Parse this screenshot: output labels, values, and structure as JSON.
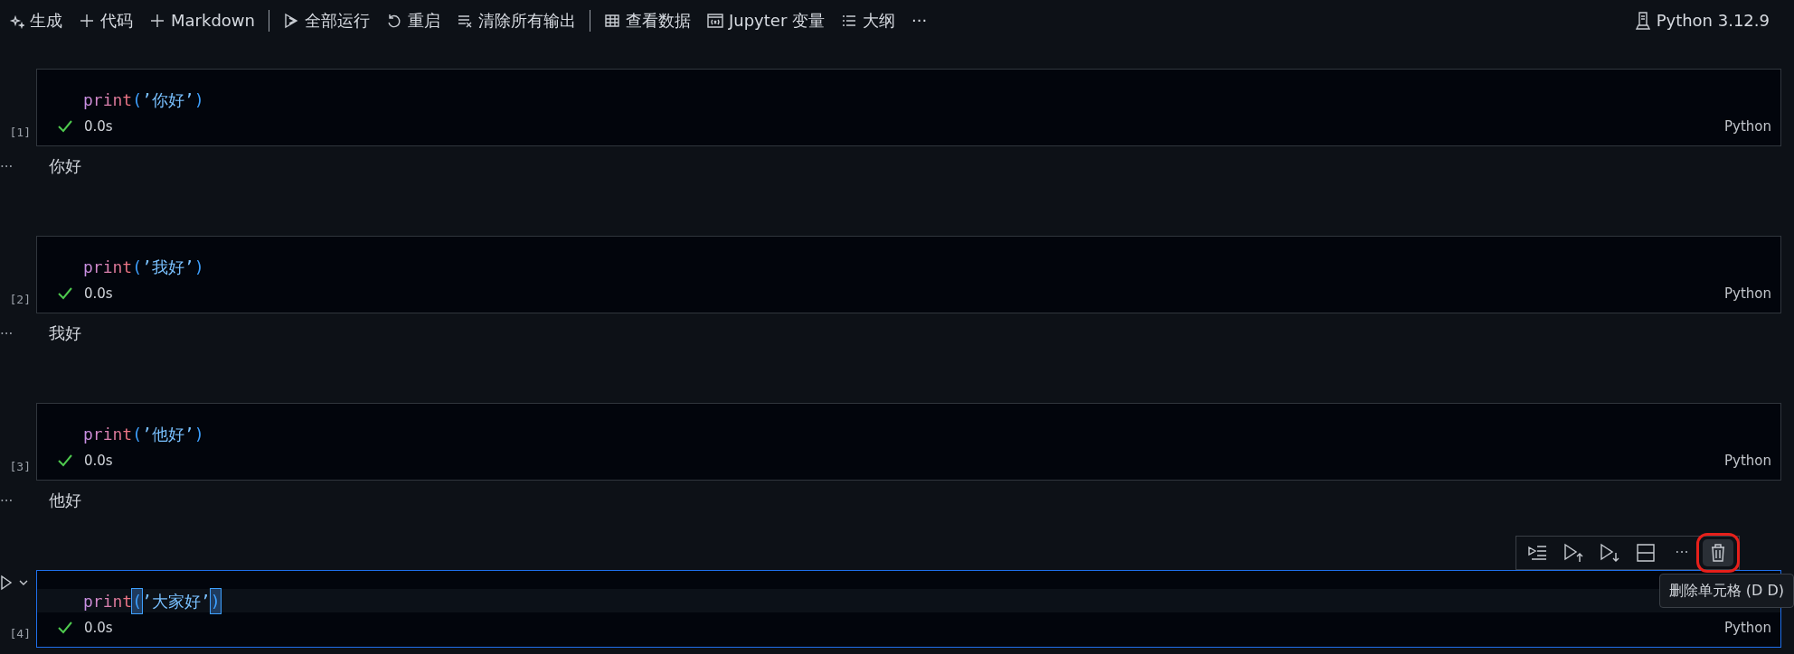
{
  "toolbar": {
    "items": [
      {
        "kind": "sparkle",
        "label": "生成"
      },
      {
        "kind": "plus",
        "label": "代码"
      },
      {
        "kind": "plus",
        "label": "Markdown"
      },
      {
        "kind": "divider"
      },
      {
        "kind": "run-all",
        "label": "全部运行"
      },
      {
        "kind": "restart",
        "label": "重启"
      },
      {
        "kind": "clear",
        "label": "清除所有输出"
      },
      {
        "kind": "divider"
      },
      {
        "kind": "data",
        "label": "查看数据"
      },
      {
        "kind": "variables",
        "label": "Jupyter 变量"
      },
      {
        "kind": "outline",
        "label": "大纲"
      },
      {
        "kind": "more",
        "label": "···"
      }
    ],
    "kernel": {
      "label": "Python 3.12.9"
    }
  },
  "cells": [
    {
      "exec_count": "[1]",
      "selected": false,
      "code": [
        {
          "kind": "function",
          "text": "print",
          "matched": false
        },
        {
          "kind": "paren",
          "text": "(",
          "matched": false
        },
        {
          "kind": "string",
          "text": "’你好’",
          "matched": false
        },
        {
          "kind": "paren",
          "text": ")",
          "matched": false
        }
      ],
      "succeeded": true,
      "status": "0.0s",
      "language": "Python",
      "output_marker": "···",
      "output": "你好"
    },
    {
      "exec_count": "[2]",
      "selected": false,
      "code": [
        {
          "kind": "function",
          "text": "print",
          "matched": false
        },
        {
          "kind": "paren",
          "text": "(",
          "matched": false
        },
        {
          "kind": "string",
          "text": "’我好’",
          "matched": false
        },
        {
          "kind": "paren",
          "text": ")",
          "matched": false
        }
      ],
      "succeeded": true,
      "status": "0.0s",
      "language": "Python",
      "output_marker": "···",
      "output": "我好"
    },
    {
      "exec_count": "[3]",
      "selected": false,
      "code": [
        {
          "kind": "function",
          "text": "print",
          "matched": false
        },
        {
          "kind": "paren",
          "text": "(",
          "matched": false
        },
        {
          "kind": "string",
          "text": "’他好’",
          "matched": false
        },
        {
          "kind": "paren",
          "text": ")",
          "matched": false
        }
      ],
      "succeeded": true,
      "status": "0.0s",
      "language": "Python",
      "output_marker": "···",
      "output": "他好"
    },
    {
      "exec_count": "[4]",
      "selected": true,
      "code": [
        {
          "kind": "function",
          "text": "print",
          "matched": false
        },
        {
          "kind": "paren",
          "text": "(",
          "matched": true
        },
        {
          "kind": "string",
          "text": "’大家好’",
          "matched": false
        },
        {
          "kind": "paren",
          "text": ")",
          "matched": true
        }
      ],
      "succeeded": true,
      "status": "0.0s",
      "language": "Python",
      "cell_toolbar": {
        "buttons": [
          {
            "kind": "run-by-line",
            "hovered": false,
            "highlighted": false
          },
          {
            "kind": "run-above",
            "hovered": false,
            "highlighted": false
          },
          {
            "kind": "run-below",
            "hovered": false,
            "highlighted": false
          },
          {
            "kind": "split",
            "hovered": false,
            "highlighted": false
          },
          {
            "kind": "more",
            "label": "···",
            "hovered": false,
            "highlighted": false
          },
          {
            "kind": "delete",
            "hovered": true,
            "highlighted": true
          }
        ],
        "tooltip": "删除单元格 (D D)"
      }
    }
  ]
}
